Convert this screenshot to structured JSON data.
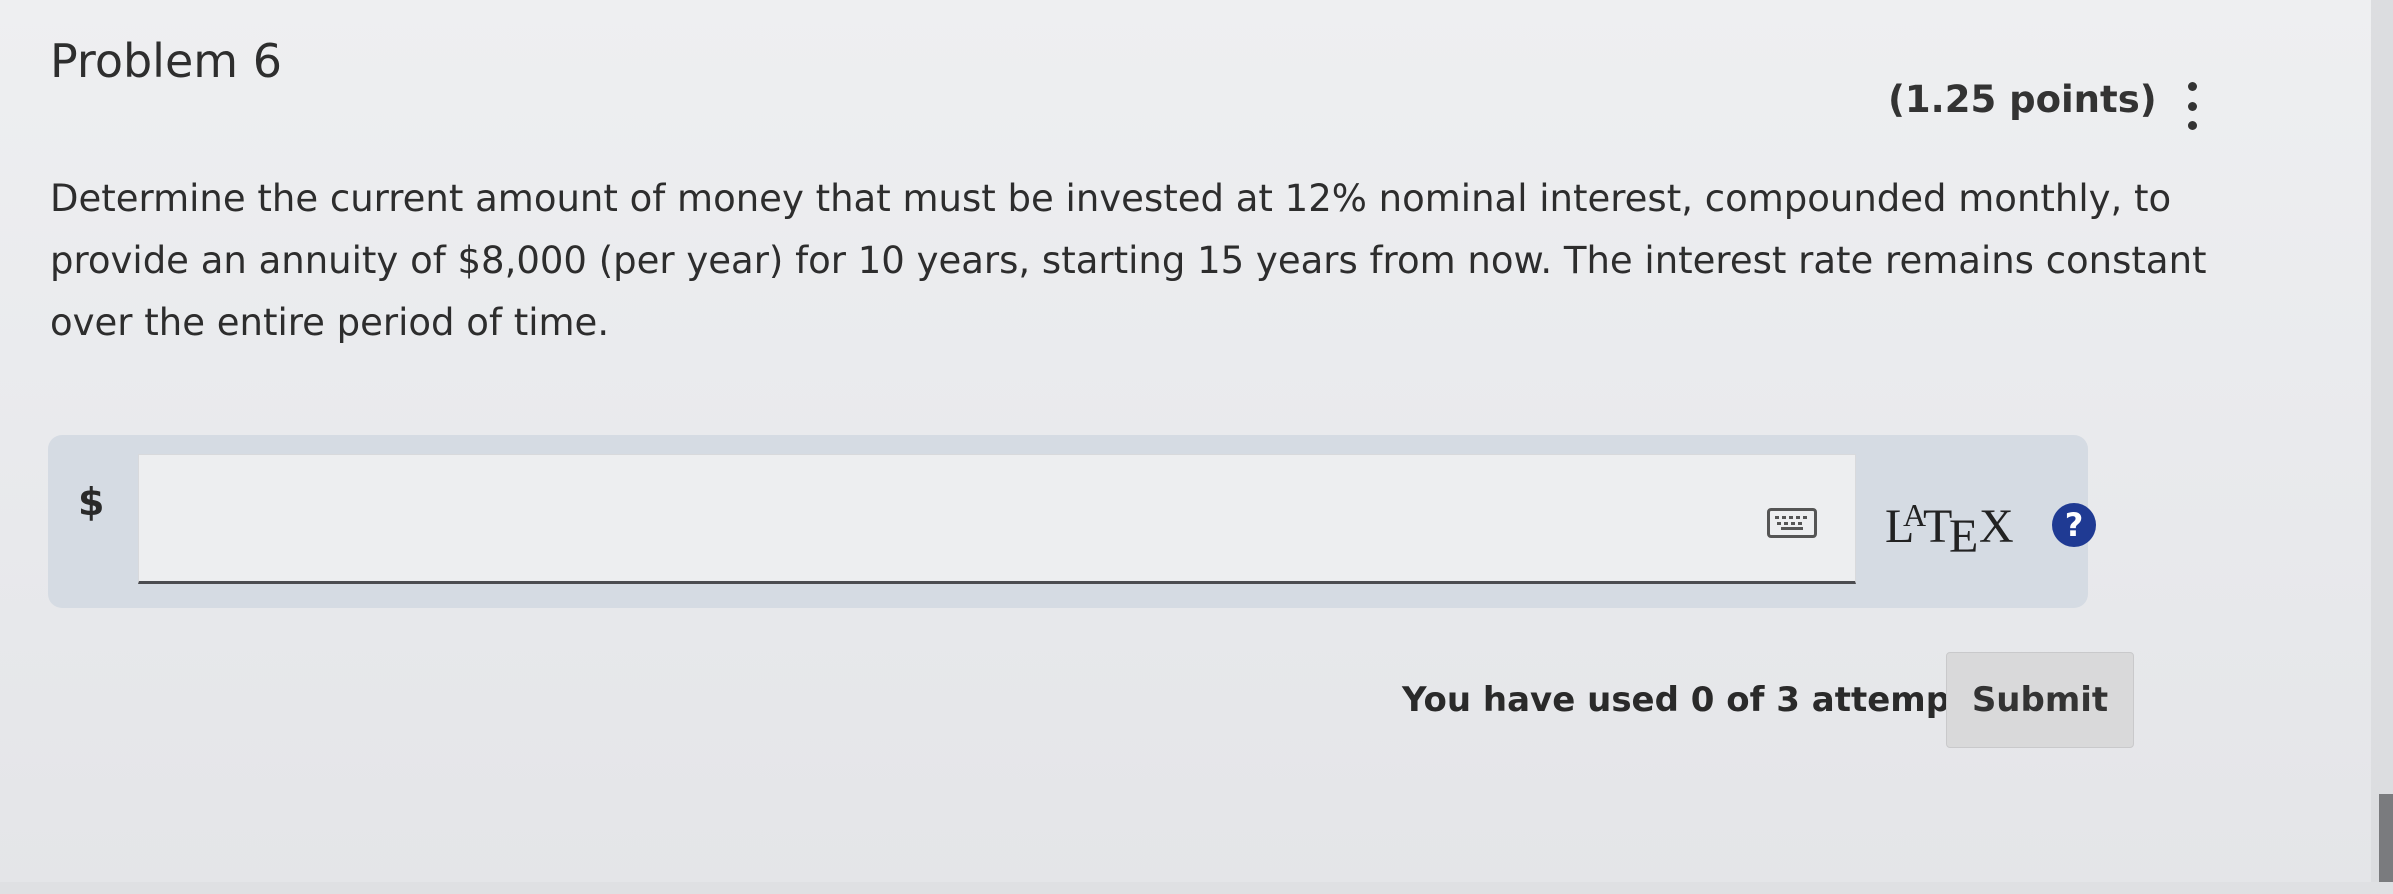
{
  "problem": {
    "title": "Problem 6",
    "points": "(1.25 points)",
    "question": "Determine the current amount of money that must be invested at 12% nominal interest, compounded monthly, to provide an annuity of $8,000 (per year) for 10 years, starting 15 years from now. The interest rate remains constant over the entire period of time."
  },
  "answer": {
    "prefix": "$",
    "value": "",
    "placeholder": "",
    "keyboard_icon": "keyboard-icon",
    "latex_label": "LaTeX",
    "help_icon": "?"
  },
  "footer": {
    "attempts_text": "You have used 0 of 3 attempts",
    "submit_label": "Submit"
  },
  "colors": {
    "help_icon_bg": "#1f3a93",
    "panel_bg": "#d5dbe3"
  }
}
